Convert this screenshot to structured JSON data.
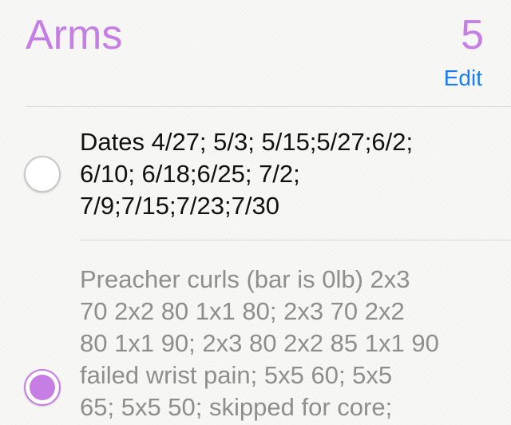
{
  "list": {
    "title": "Arms",
    "count": "5",
    "edit_label": "Edit",
    "accent_color": "#c77ee4",
    "link_color": "#1a7ef2"
  },
  "items": [
    {
      "text": "Dates 4/27; 5/3; 5/15;5/27;6/2;\n6/10; 6/18;6/25; 7/2;\n7/9;7/15;7/23;7/30",
      "completed": false
    },
    {
      "text": "Preacher curls (bar is 0lb) 2x3\n70 2x2 80 1x1 80; 2x3  70 2x2\n80 1x1 90; 2x3 80 2x2 85 1x1 90\nfailed wrist pain; 5x5 60; 5x5\n65; 5x5 50; skipped for core;",
      "completed": true
    }
  ]
}
